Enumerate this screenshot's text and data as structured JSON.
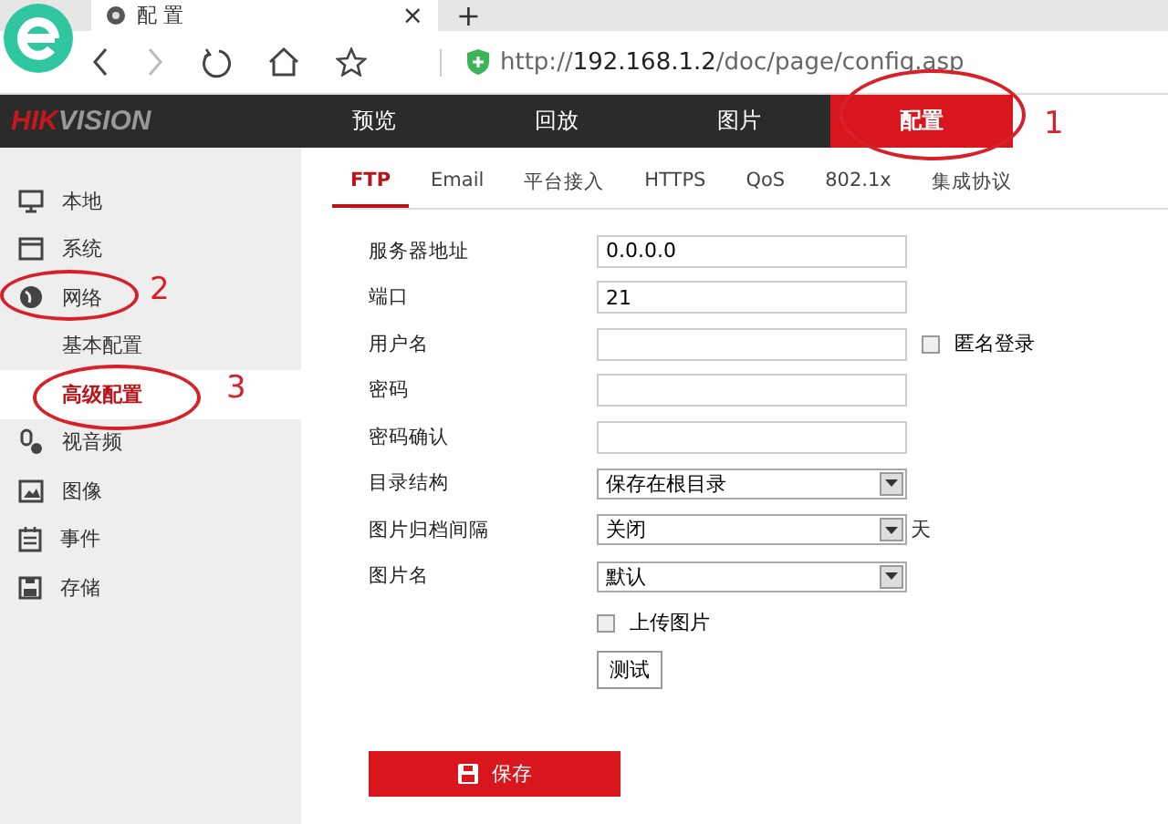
{
  "browser": {
    "tab_title": "配 置",
    "close": "×",
    "new_tab": "+",
    "url_scheme": "http://",
    "url_host": "192.168.1.2",
    "url_path": "/doc/page/config.asp"
  },
  "header": {
    "logo_red": "HIK",
    "logo_gray": "VISION",
    "nav": [
      {
        "label": "预览",
        "selected": false
      },
      {
        "label": "回放",
        "selected": false
      },
      {
        "label": "图片",
        "selected": false
      },
      {
        "label": "配置",
        "selected": true
      }
    ]
  },
  "sidebar": {
    "items": [
      {
        "label": "本地",
        "selected": false
      },
      {
        "label": "系统",
        "selected": false
      },
      {
        "label": "网络",
        "selected": false,
        "children": [
          {
            "label": "基本配置",
            "selected": false
          },
          {
            "label": "高级配置",
            "selected": true
          }
        ]
      },
      {
        "label": "视音频",
        "selected": false
      },
      {
        "label": "图像",
        "selected": false
      },
      {
        "label": "事件",
        "selected": false
      },
      {
        "label": "存储",
        "selected": false
      }
    ]
  },
  "tabs": [
    {
      "label": "FTP",
      "selected": true
    },
    {
      "label": "Email",
      "selected": false
    },
    {
      "label": "平台接入",
      "selected": false
    },
    {
      "label": "HTTPS",
      "selected": false
    },
    {
      "label": "QoS",
      "selected": false
    },
    {
      "label": "802.1x",
      "selected": false
    },
    {
      "label": "集成协议",
      "selected": false
    }
  ],
  "form": [
    {
      "kind": "text",
      "label": "服务器地址",
      "value": "0.0.0.0"
    },
    {
      "kind": "text",
      "label": "端口",
      "value": "21"
    },
    {
      "kind": "text",
      "label": "用户名",
      "check": {
        "label": "匿名登录",
        "checked": false
      }
    },
    {
      "kind": "text",
      "label": "密码"
    },
    {
      "kind": "text",
      "label": "密码确认"
    },
    {
      "kind": "select",
      "label": "目录结构",
      "value": "保存在根目录"
    },
    {
      "kind": "select",
      "label": "图片归档间隔",
      "value": "关闭",
      "suffix": "天"
    },
    {
      "kind": "select",
      "label": "图片名",
      "value": "默认"
    },
    {
      "kind": "checkbox",
      "label": "上传图片",
      "checked": false
    },
    {
      "kind": "button",
      "label": "测试"
    }
  ],
  "save_button": "保存",
  "annotations": [
    "1",
    "2",
    "3"
  ]
}
